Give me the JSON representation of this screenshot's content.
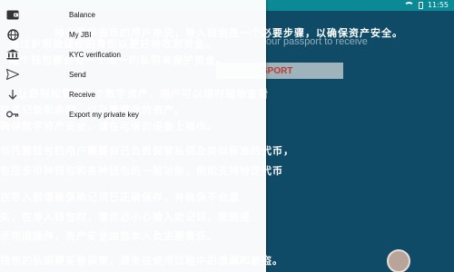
{
  "status_bar": {
    "time": "11:55"
  },
  "drawer": {
    "items": [
      {
        "icon": "wallet-icon",
        "label": "Balance"
      },
      {
        "icon": "globe-icon",
        "label": "My JBI"
      },
      {
        "icon": "bank-icon",
        "label": "KYC verification"
      },
      {
        "icon": "send-icon",
        "label": "Send"
      },
      {
        "icon": "arrow-down-icon",
        "label": "Receive"
      },
      {
        "icon": "key-icon",
        "label": "Export my private key"
      }
    ]
  },
  "background": {
    "lines": [
      "持有数字货币的用户来说，导入钱包是一个必要步骤，以确保资产安全。",
      "每个钱包都会有一个唯一的私钥来保护资金。",
      "通过护照验证你的身份以更好地收到资金。",
      "让您轻松管理多个数字资产，用户可以随时随地查看",
      "交易记录和余额，以及管理你的资产。",
      "确保数字资产安全，请在可信的设备上操作。",
      "非托管钱包的用户需要自己负责保管私钥及类似标准的代币，",
      "包括多币种钱包和各种钱包的一般功能，例如支持特定代币",
      "在导入前请确保助记词已正确保存，并确保不会遗",
      "失，在导入钱包时，请务必小心输入助记词，按照提",
      "示完成操作，资产安全由您本人负主要责任。",
      "钱包的私钥要妥善保管，避免在使用过程中的遗漏和被盗。"
    ],
    "subtitle": "our passport to receive",
    "button_label": "SPORT"
  },
  "colors": {
    "background": "#0f4b67",
    "status_bar": "#0b8a95",
    "drawer": "#ffffff",
    "button_text": "#c0392b"
  }
}
